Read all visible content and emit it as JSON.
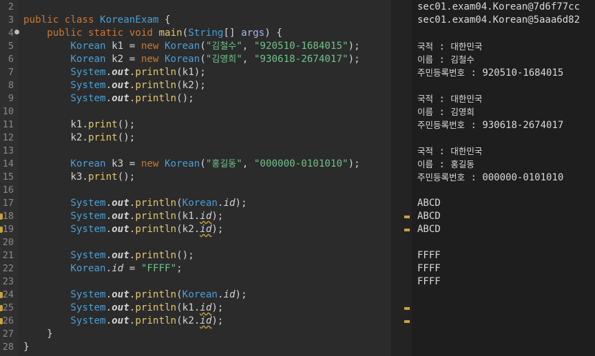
{
  "editor": {
    "lines": [
      {
        "n": "2",
        "tokens": []
      },
      {
        "n": "3",
        "tokens": [
          [
            "kw",
            "public class "
          ],
          [
            "cls",
            "KoreanExam"
          ],
          [
            "plain",
            " {"
          ]
        ]
      },
      {
        "n": "4",
        "marker": "override",
        "tokens": [
          [
            "plain",
            "    "
          ],
          [
            "kw",
            "public static void "
          ],
          [
            "fn",
            "main"
          ],
          [
            "plain",
            "("
          ],
          [
            "type",
            "String"
          ],
          [
            "plain",
            "[] "
          ],
          [
            "param",
            "args"
          ],
          [
            "plain",
            ") {"
          ]
        ]
      },
      {
        "n": "5",
        "tokens": [
          [
            "plain",
            "        "
          ],
          [
            "type",
            "Korean"
          ],
          [
            "var",
            " k1"
          ],
          [
            "plain",
            " = "
          ],
          [
            "kw",
            "new "
          ],
          [
            "type",
            "Korean"
          ],
          [
            "plain",
            "("
          ],
          [
            "str",
            "\""
          ],
          [
            "strk",
            "김철수"
          ],
          [
            "str",
            "\""
          ],
          [
            "plain",
            ", "
          ],
          [
            "str",
            "\"920510-1684015\""
          ],
          [
            "plain",
            ");"
          ]
        ]
      },
      {
        "n": "6",
        "tokens": [
          [
            "plain",
            "        "
          ],
          [
            "type",
            "Korean"
          ],
          [
            "var",
            " k2"
          ],
          [
            "plain",
            " = "
          ],
          [
            "kw",
            "new "
          ],
          [
            "type",
            "Korean"
          ],
          [
            "plain",
            "("
          ],
          [
            "str",
            "\""
          ],
          [
            "strk",
            "김영희"
          ],
          [
            "str",
            "\""
          ],
          [
            "plain",
            ", "
          ],
          [
            "str",
            "\"930618-2674017\""
          ],
          [
            "plain",
            ");"
          ]
        ]
      },
      {
        "n": "7",
        "tokens": [
          [
            "plain",
            "        "
          ],
          [
            "type",
            "System"
          ],
          [
            "plain",
            "."
          ],
          [
            "static",
            "out"
          ],
          [
            "plain",
            "."
          ],
          [
            "fn",
            "println"
          ],
          [
            "plain",
            "(k1);"
          ]
        ]
      },
      {
        "n": "8",
        "tokens": [
          [
            "plain",
            "        "
          ],
          [
            "type",
            "System"
          ],
          [
            "plain",
            "."
          ],
          [
            "static",
            "out"
          ],
          [
            "plain",
            "."
          ],
          [
            "fn",
            "println"
          ],
          [
            "plain",
            "(k2);"
          ]
        ]
      },
      {
        "n": "9",
        "tokens": [
          [
            "plain",
            "        "
          ],
          [
            "type",
            "System"
          ],
          [
            "plain",
            "."
          ],
          [
            "static",
            "out"
          ],
          [
            "plain",
            "."
          ],
          [
            "fn",
            "println"
          ],
          [
            "plain",
            "();"
          ]
        ]
      },
      {
        "n": "10",
        "tokens": []
      },
      {
        "n": "11",
        "tokens": [
          [
            "plain",
            "        k1."
          ],
          [
            "fn",
            "print"
          ],
          [
            "plain",
            "();"
          ]
        ]
      },
      {
        "n": "12",
        "tokens": [
          [
            "plain",
            "        k2."
          ],
          [
            "fn",
            "print"
          ],
          [
            "plain",
            "();"
          ]
        ]
      },
      {
        "n": "13",
        "tokens": []
      },
      {
        "n": "14",
        "tokens": [
          [
            "plain",
            "        "
          ],
          [
            "type",
            "Korean"
          ],
          [
            "var",
            " k3"
          ],
          [
            "plain",
            " = "
          ],
          [
            "kw",
            "new "
          ],
          [
            "type",
            "Korean"
          ],
          [
            "plain",
            "("
          ],
          [
            "str",
            "\""
          ],
          [
            "strk",
            "홍길동"
          ],
          [
            "str",
            "\""
          ],
          [
            "plain",
            ", "
          ],
          [
            "str",
            "\"000000-0101010\""
          ],
          [
            "plain",
            ");"
          ]
        ]
      },
      {
        "n": "15",
        "tokens": [
          [
            "plain",
            "        k3."
          ],
          [
            "fn",
            "print"
          ],
          [
            "plain",
            "();"
          ]
        ]
      },
      {
        "n": "16",
        "tokens": []
      },
      {
        "n": "17",
        "tokens": [
          [
            "plain",
            "        "
          ],
          [
            "type",
            "System"
          ],
          [
            "plain",
            "."
          ],
          [
            "static",
            "out"
          ],
          [
            "plain",
            "."
          ],
          [
            "fn",
            "println"
          ],
          [
            "plain",
            "("
          ],
          [
            "type",
            "Korean"
          ],
          [
            "plain",
            "."
          ],
          [
            "field",
            "id"
          ],
          [
            "plain",
            ");"
          ]
        ]
      },
      {
        "n": "18",
        "warn": true,
        "tokens": [
          [
            "plain",
            "        "
          ],
          [
            "type",
            "System"
          ],
          [
            "plain",
            "."
          ],
          [
            "static",
            "out"
          ],
          [
            "plain",
            "."
          ],
          [
            "fn",
            "println"
          ],
          [
            "plain",
            "(k1."
          ],
          [
            "fieldw",
            "id"
          ],
          [
            "plain",
            ");"
          ]
        ]
      },
      {
        "n": "19",
        "warn": true,
        "tokens": [
          [
            "plain",
            "        "
          ],
          [
            "type",
            "System"
          ],
          [
            "plain",
            "."
          ],
          [
            "static",
            "out"
          ],
          [
            "plain",
            "."
          ],
          [
            "fn",
            "println"
          ],
          [
            "plain",
            "(k2."
          ],
          [
            "fieldw",
            "id"
          ],
          [
            "plain",
            ");"
          ]
        ]
      },
      {
        "n": "20",
        "tokens": []
      },
      {
        "n": "21",
        "tokens": [
          [
            "plain",
            "        "
          ],
          [
            "type",
            "System"
          ],
          [
            "plain",
            "."
          ],
          [
            "static",
            "out"
          ],
          [
            "plain",
            "."
          ],
          [
            "fn",
            "println"
          ],
          [
            "plain",
            "();"
          ]
        ]
      },
      {
        "n": "22",
        "tokens": [
          [
            "plain",
            "        "
          ],
          [
            "type",
            "Korean"
          ],
          [
            "plain",
            "."
          ],
          [
            "field",
            "id"
          ],
          [
            "plain",
            " = "
          ],
          [
            "str",
            "\"FFFF\""
          ],
          [
            "plain",
            ";"
          ]
        ]
      },
      {
        "n": "23",
        "tokens": []
      },
      {
        "n": "24",
        "warn": true,
        "tokens": [
          [
            "plain",
            "        "
          ],
          [
            "type",
            "System"
          ],
          [
            "plain",
            "."
          ],
          [
            "static",
            "out"
          ],
          [
            "plain",
            "."
          ],
          [
            "fn",
            "println"
          ],
          [
            "plain",
            "("
          ],
          [
            "type",
            "Korean"
          ],
          [
            "plain",
            "."
          ],
          [
            "field",
            "id"
          ],
          [
            "plain",
            ");"
          ]
        ]
      },
      {
        "n": "25",
        "warn": true,
        "tokens": [
          [
            "plain",
            "        "
          ],
          [
            "type",
            "System"
          ],
          [
            "plain",
            "."
          ],
          [
            "static",
            "out"
          ],
          [
            "plain",
            "."
          ],
          [
            "fn",
            "println"
          ],
          [
            "plain",
            "(k1."
          ],
          [
            "fieldw",
            "id"
          ],
          [
            "plain",
            ");"
          ]
        ]
      },
      {
        "n": "26",
        "warn": true,
        "tokens": [
          [
            "plain",
            "        "
          ],
          [
            "type",
            "System"
          ],
          [
            "plain",
            "."
          ],
          [
            "static",
            "out"
          ],
          [
            "plain",
            "."
          ],
          [
            "fn",
            "println"
          ],
          [
            "plain",
            "(k2."
          ],
          [
            "fieldw",
            "id"
          ],
          [
            "plain",
            ");"
          ]
        ]
      },
      {
        "n": "27",
        "tokens": [
          [
            "plain",
            "    }"
          ]
        ]
      },
      {
        "n": "28",
        "tokens": [
          [
            "plain",
            "}"
          ]
        ]
      }
    ]
  },
  "console": {
    "lines": [
      {
        "text": "sec01.exam04.Korean@7d6f77cc"
      },
      {
        "text": "sec01.exam04.Korean@5aaa6d82"
      },
      {
        "text": ""
      },
      {
        "k": "국적",
        "sep": " : ",
        "v": "대한민국"
      },
      {
        "k": "이름",
        "sep": " : ",
        "v": "김철수"
      },
      {
        "k": "주민등록번호",
        "sep": " : ",
        "v": "920510-1684015"
      },
      {
        "text": ""
      },
      {
        "k": "국적",
        "sep": " : ",
        "v": "대한민국"
      },
      {
        "k": "이름",
        "sep": " : ",
        "v": "김영희"
      },
      {
        "k": "주민등록번호",
        "sep": " : ",
        "v": "930618-2674017"
      },
      {
        "text": ""
      },
      {
        "k": "국적",
        "sep": " : ",
        "v": "대한민국"
      },
      {
        "k": "이름",
        "sep": " : ",
        "v": "홍길동"
      },
      {
        "k": "주민등록번호",
        "sep": " : ",
        "v": "000000-0101010"
      },
      {
        "text": ""
      },
      {
        "text": "ABCD"
      },
      {
        "text": "ABCD"
      },
      {
        "text": "ABCD"
      },
      {
        "text": ""
      },
      {
        "text": "FFFF"
      },
      {
        "text": "FFFF"
      },
      {
        "text": "FFFF"
      }
    ]
  },
  "overview_marks": [
    {
      "line": "18"
    },
    {
      "line": "19"
    },
    {
      "line": "25"
    },
    {
      "line": "26"
    }
  ],
  "colors": {
    "editor_bg": "#2b2b2b",
    "console_bg": "#1e1e1e",
    "keyword": "#cc7832",
    "type": "#4a9fd6",
    "string": "#6fc48a",
    "method": "#e2c86a",
    "warning": "#c9a33a"
  }
}
